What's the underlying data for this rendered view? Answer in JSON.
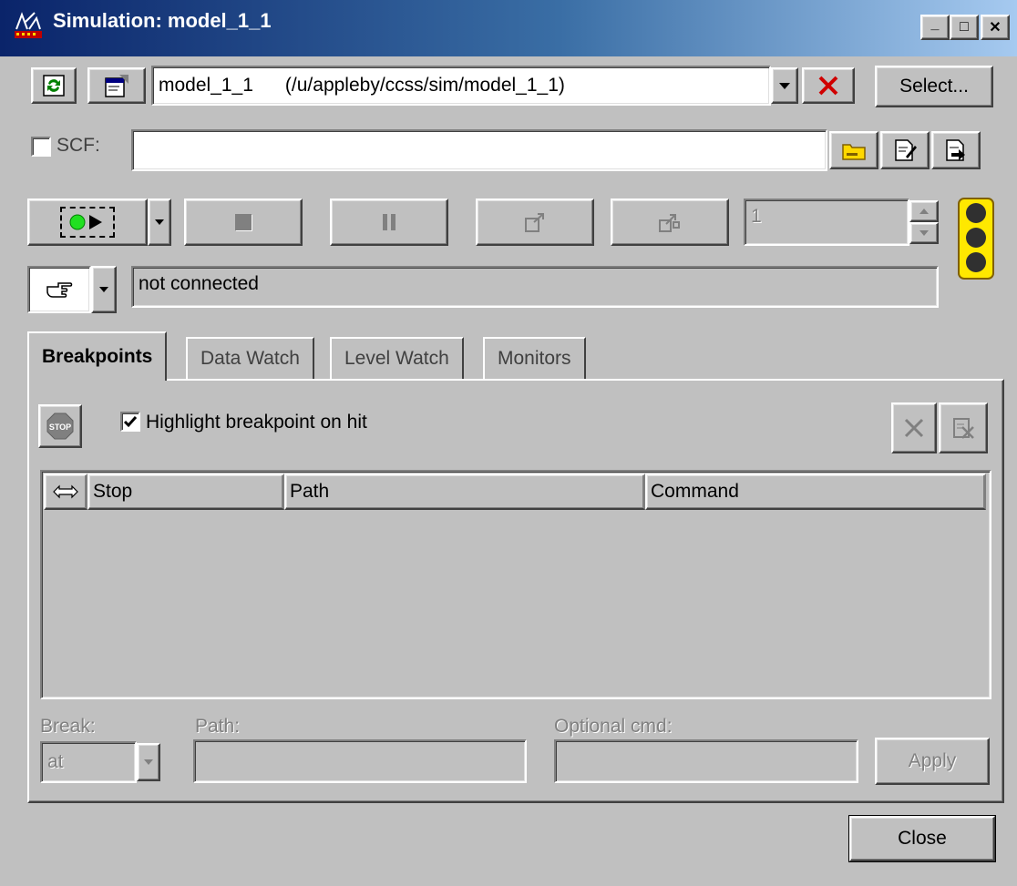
{
  "window": {
    "title": "Simulation: model_1_1",
    "minimize_glyph": "_",
    "maximize_glyph": "□",
    "close_glyph": "✕"
  },
  "model_row": {
    "model_value": "model_1_1      (/u/appleby/ccss/sim/model_1_1)",
    "select_label": "Select..."
  },
  "scf_row": {
    "checkbox_label": "SCF:",
    "checked": false,
    "path_value": ""
  },
  "controls": {
    "step_count": "1"
  },
  "status": {
    "text": "not connected"
  },
  "tabs": [
    {
      "label": "Breakpoints",
      "active": true
    },
    {
      "label": "Data Watch",
      "active": false
    },
    {
      "label": "Level Watch",
      "active": false
    },
    {
      "label": "Monitors",
      "active": false
    }
  ],
  "breakpoints": {
    "highlight_label": "Highlight breakpoint on hit",
    "highlight_checked": true,
    "stop_icon_text": "STOP",
    "columns": [
      "Stop",
      "Path",
      "Command"
    ],
    "rows": []
  },
  "editor": {
    "break_label": "Break:",
    "break_value": "at",
    "path_label": "Path:",
    "path_value": "",
    "cmd_label": "Optional cmd:",
    "cmd_value": "",
    "apply_label": "Apply"
  },
  "footer": {
    "close_label": "Close"
  }
}
